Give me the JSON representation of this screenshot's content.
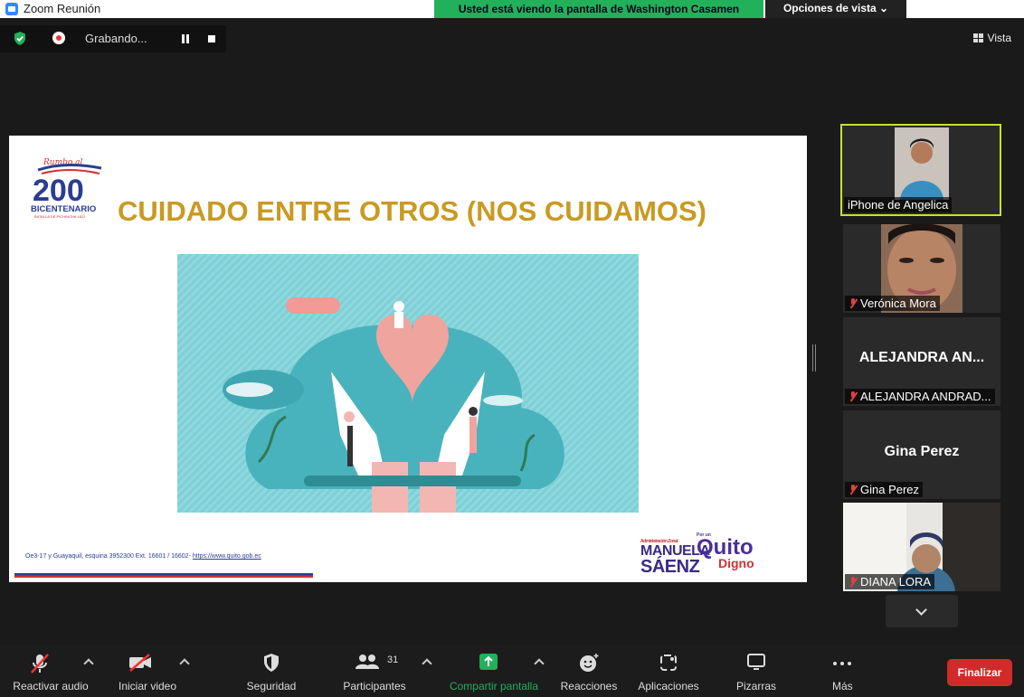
{
  "window": {
    "title": "Zoom Reunión"
  },
  "banner": {
    "viewing": "Usted está viendo la pantalla de Washington Casamen",
    "view_options": "Opciones de vista ⌄"
  },
  "recording": {
    "label": "Grabando..."
  },
  "top_right": {
    "view": "Vista"
  },
  "slide": {
    "title": "CUIDADO ENTRE OTROS (NOS CUIDAMOS)",
    "logo_script": "Rumbo al",
    "logo_number": "200",
    "logo_text": "BICENTENARIO",
    "logo_sub": "BATALLA DE PICHINCHA 1822",
    "footer": "Oe3-17 y Guayaquil, esquina 3952300 Ext. 16601 / 16602-",
    "footer_link": "https://www.quito.gob.ec",
    "brand_small": "Administración Zonal",
    "brand_manuela": "MANUELA",
    "brand_saenz": "SÁENZ",
    "brand_quito_pre": "Por un",
    "brand_quito": "Quito",
    "brand_digno": "Digno"
  },
  "participants": [
    {
      "name": "iPhone de Angelica",
      "muted": false,
      "video": true,
      "active": true
    },
    {
      "name": "Verónica Mora",
      "muted": true,
      "video": true
    },
    {
      "name": "ALEJANDRA ANDRAD...",
      "display": "ALEJANDRA AN...",
      "muted": true,
      "video": false
    },
    {
      "name": "Gina Perez",
      "display": "Gina Perez",
      "muted": true,
      "video": false
    },
    {
      "name": "DIANA LORA",
      "muted": true,
      "video": true
    }
  ],
  "toolbar": {
    "audio": "Reactivar audio",
    "video": "Iniciar video",
    "security": "Seguridad",
    "participants": "Participantes",
    "participants_count": "31",
    "share": "Compartir pantalla",
    "reactions": "Reacciones",
    "apps": "Aplicaciones",
    "whiteboards": "Pizarras",
    "more": "Más",
    "end": "Finalizar"
  },
  "colors": {
    "active_border": "#c8e032",
    "share_green": "#23b05a",
    "end_red": "#d12a2a",
    "title_gold": "#c99a22"
  }
}
